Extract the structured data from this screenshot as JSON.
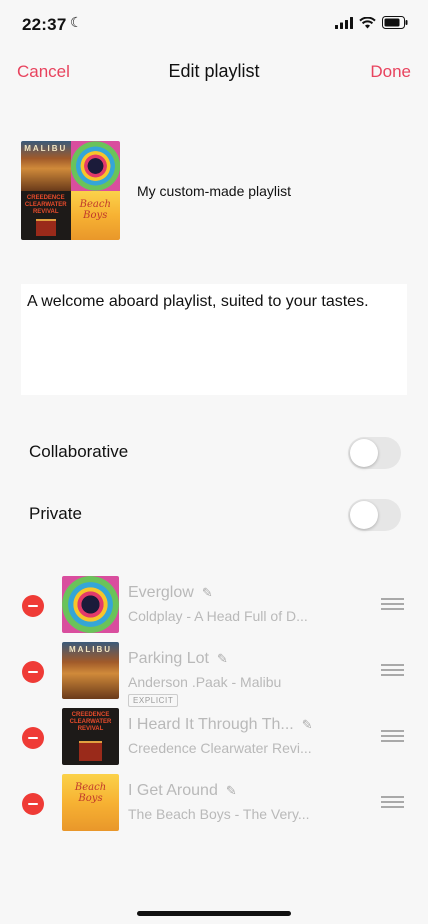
{
  "status_bar": {
    "time": "22:37"
  },
  "nav": {
    "cancel_label": "Cancel",
    "title": "Edit playlist",
    "done_label": "Done"
  },
  "playlist": {
    "name": "My custom-made playlist",
    "description": "A welcome aboard playlist, suited to your tastes."
  },
  "settings": [
    {
      "label": "Collaborative",
      "on": false
    },
    {
      "label": "Private",
      "on": false
    }
  ],
  "tracks": [
    {
      "title": "Everglow",
      "subtitle": "Coldplay - A Head Full of D...",
      "explicit": ""
    },
    {
      "title": "Parking Lot",
      "subtitle": "Anderson .Paak - Malibu",
      "explicit": "EXPLICIT"
    },
    {
      "title": "I Heard It Through Th...",
      "subtitle": "Creedence Clearwater Revi...",
      "explicit": ""
    },
    {
      "title": "I Get Around",
      "subtitle": "The Beach Boys - The Very...",
      "explicit": ""
    }
  ],
  "artwork_text": {
    "malibu": "MALIBU",
    "ccr": "CREEDENCE CLEARWATER REVIVAL",
    "beach_boys": "Beach Boys"
  },
  "colors": {
    "accent": "#e8435e",
    "remove": "#ef3b36",
    "muted_text": "#b9b9b9",
    "toggle_off": "#e6e6e6"
  }
}
